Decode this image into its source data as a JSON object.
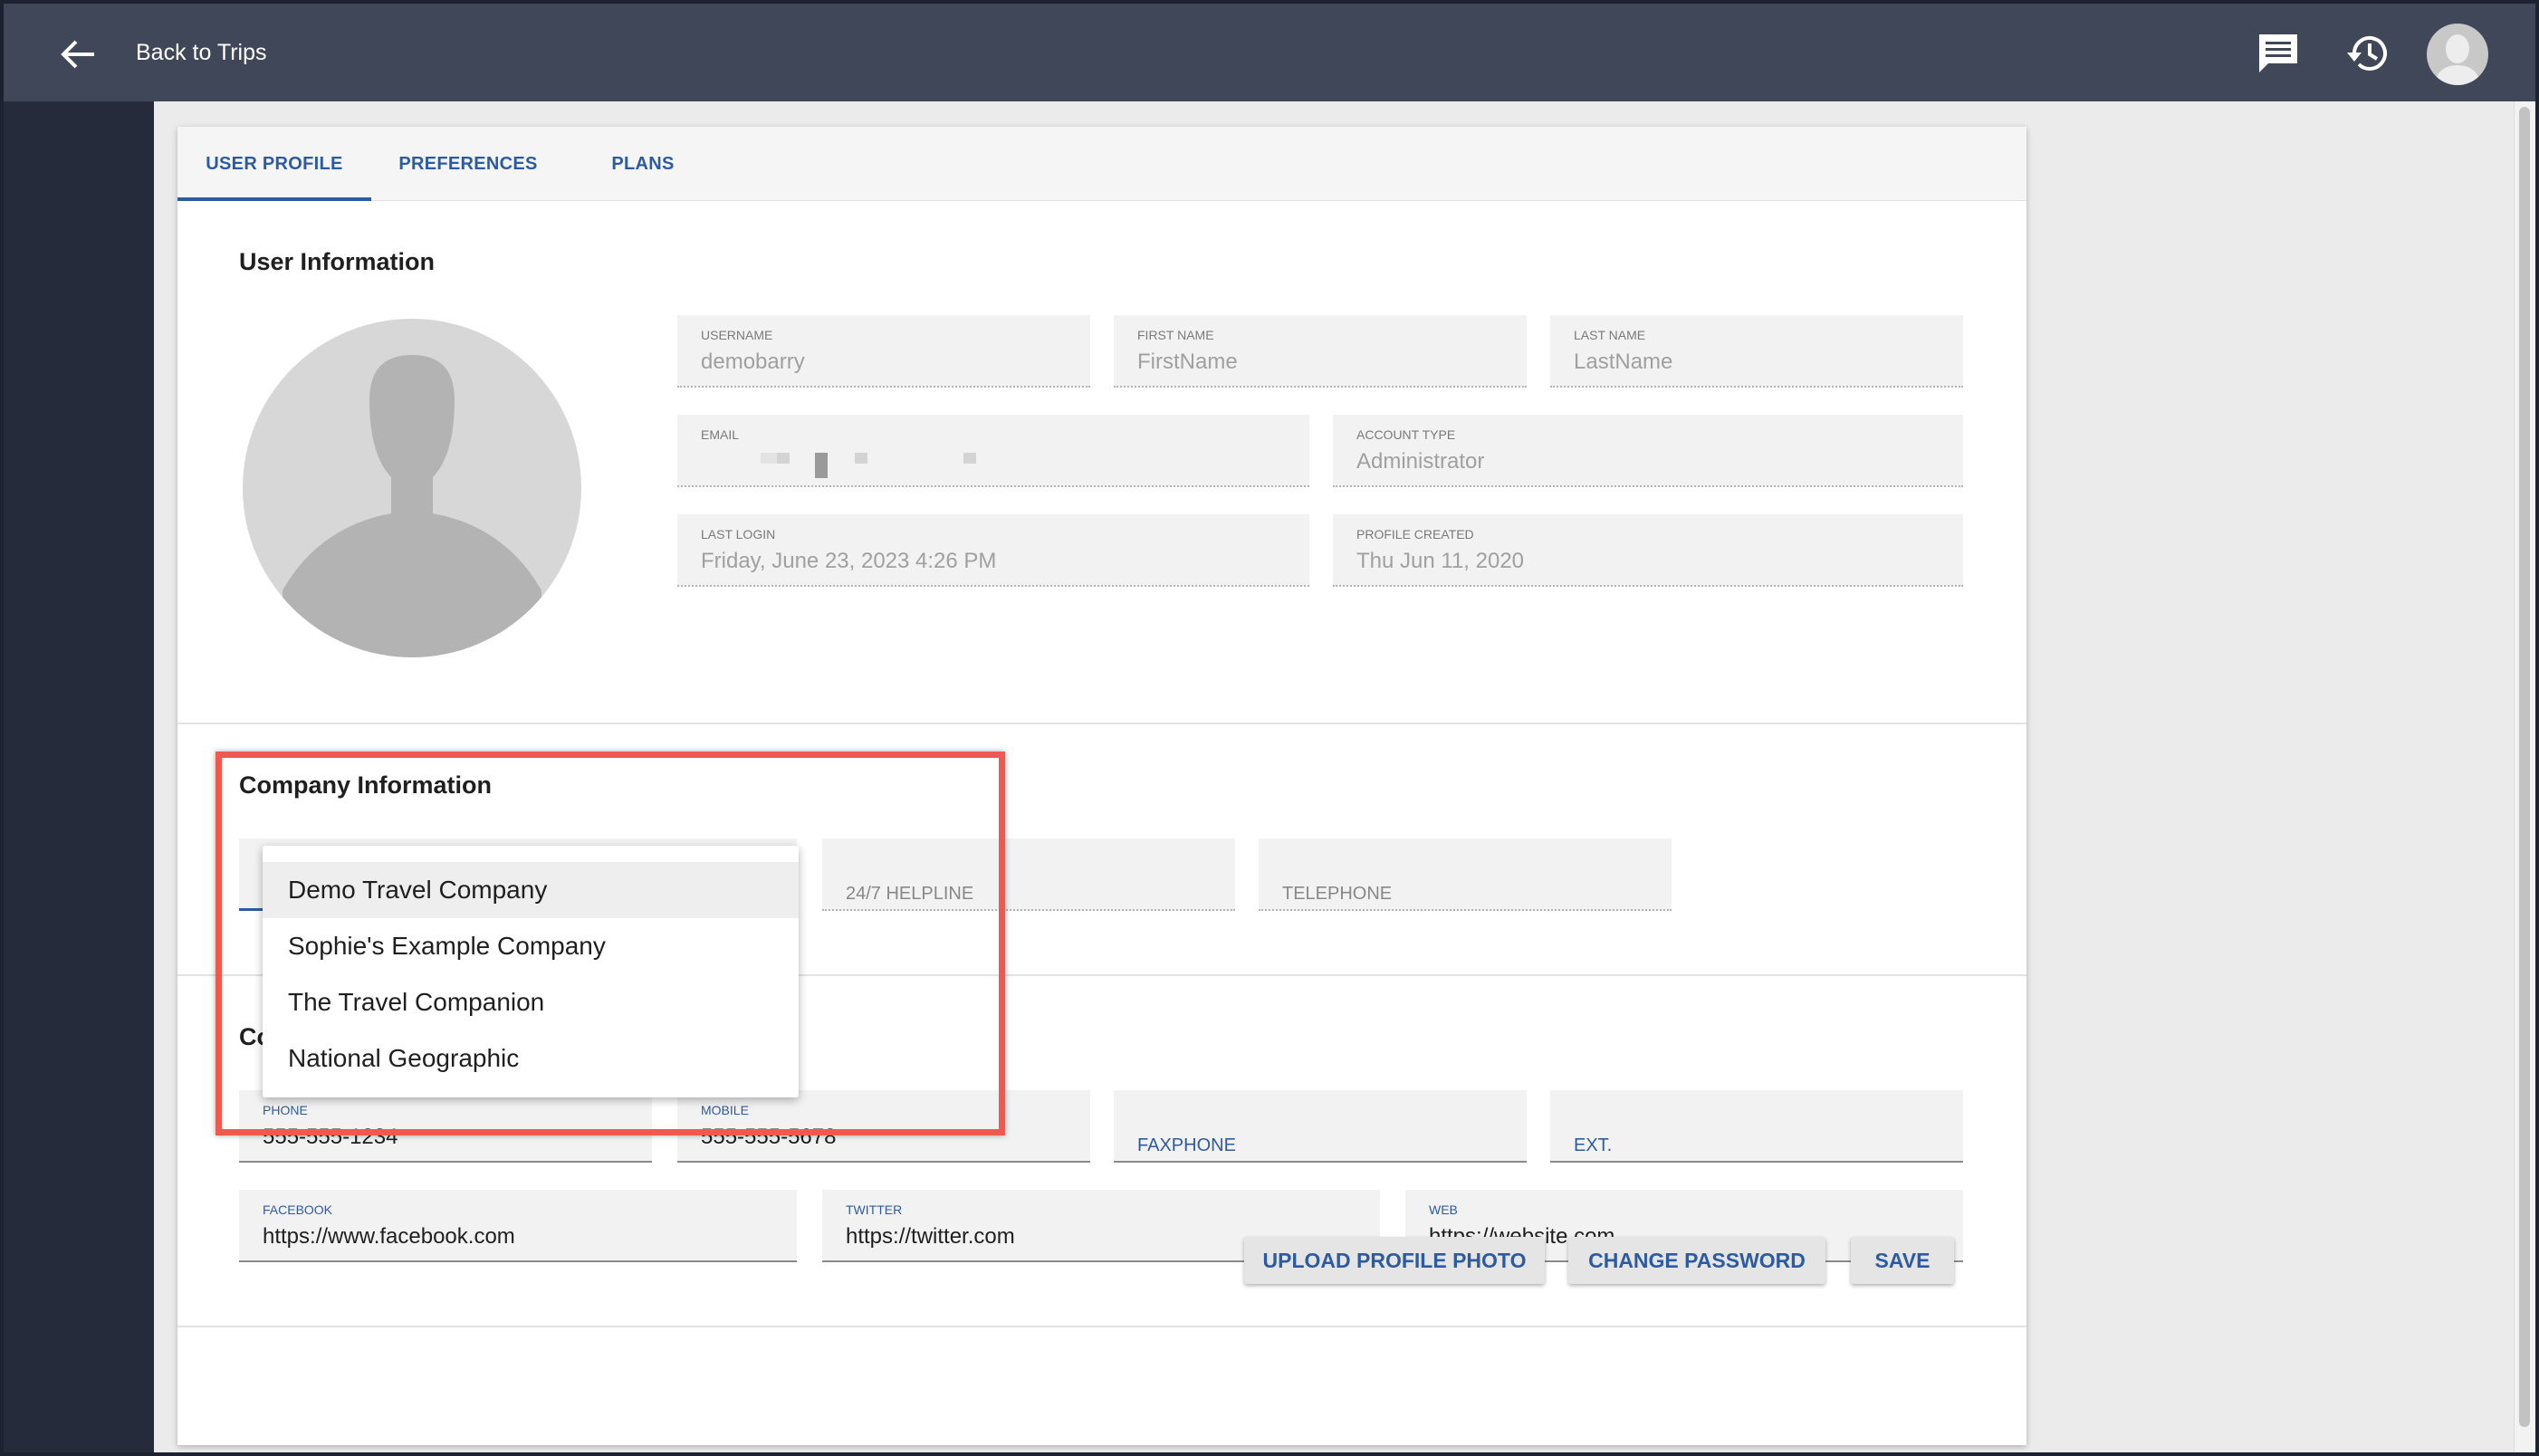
{
  "topbar": {
    "back_label": "Back to Trips",
    "icons": [
      "arrow-left-icon",
      "message-icon",
      "history-icon",
      "avatar-icon"
    ]
  },
  "tabs": [
    {
      "label": "USER PROFILE",
      "active": true
    },
    {
      "label": "PREFERENCES",
      "active": false
    },
    {
      "label": "PLANS",
      "active": false
    }
  ],
  "user_info": {
    "title": "User Information",
    "username": {
      "label": "USERNAME",
      "value": "demobarry"
    },
    "first_name": {
      "label": "FIRST NAME",
      "value": "FirstName"
    },
    "last_name": {
      "label": "LAST NAME",
      "value": "LastName"
    },
    "email": {
      "label": "EMAIL"
    },
    "account_type": {
      "label": "ACCOUNT TYPE",
      "value": "Administrator"
    },
    "last_login": {
      "label": "LAST LOGIN",
      "value": "Friday, June 23, 2023 4:26 PM"
    },
    "profile_created": {
      "label": "PROFILE CREATED",
      "value": "Thu Jun 11, 2020"
    }
  },
  "company_info": {
    "title": "Company Information",
    "helpline_placeholder": "24/7 HELPLINE",
    "telephone_placeholder": "TELEPHONE",
    "dropdown_options": [
      "Demo Travel Company",
      "Sophie's Example Company",
      "The Travel Companion",
      "National Geographic"
    ],
    "selected": "Demo Travel Company"
  },
  "contact_info": {
    "title_visible": "Co",
    "phone": {
      "label": "PHONE",
      "value": "555-555-1234"
    },
    "mobile": {
      "label": "MOBILE",
      "value": "555-555-5678"
    },
    "faxphone_placeholder": "FAXPHONE",
    "ext_placeholder": "EXT.",
    "facebook": {
      "label": "FACEBOOK",
      "value": "https://www.facebook.com"
    },
    "twitter": {
      "label": "TWITTER",
      "value": "https://twitter.com"
    },
    "web": {
      "label": "WEB",
      "value": "https://website.com"
    }
  },
  "buttons": {
    "upload": "UPLOAD PROFILE PHOTO",
    "change_password": "CHANGE PASSWORD",
    "save": "SAVE"
  },
  "colors": {
    "accent": "#2d5ba3",
    "topbar": "#3f4759",
    "highlight": "#ee5a52"
  }
}
